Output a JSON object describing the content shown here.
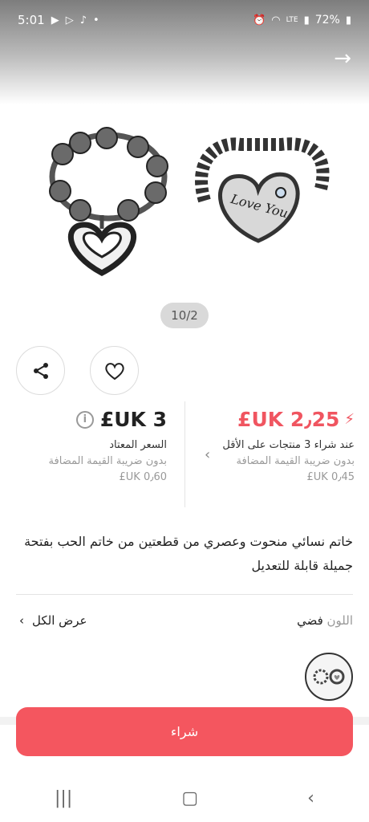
{
  "status": {
    "time": "5:01",
    "battery": "72%",
    "lte_label": "LTE"
  },
  "gallery": {
    "counter": "10/2",
    "engraving": "Love You"
  },
  "pricing": {
    "sale_price": "£UK 2٫25",
    "sale_condition": "عند شراء 3 منتجات على الأقل",
    "sale_vat_note": "بدون ضريبة القيمة المضافة",
    "sale_vat_amount": "£UK 0٫45",
    "regular_price": "£UK 3",
    "regular_label": "السعر المعتاد",
    "regular_vat_note": "بدون ضريبة القيمة المضافة",
    "regular_vat_amount": "£UK 0٫60"
  },
  "product": {
    "description": "خاتم نسائي منحوت وعصري من قطعتين من خاتم الحب بفتحة جميلة قابلة للتعديل"
  },
  "variant": {
    "color_key": "اللون",
    "color_value": "فضي",
    "view_all": "عرض الكل"
  },
  "actions": {
    "buy_label": "شراء"
  },
  "colors": {
    "accent": "#f4565f",
    "sale_price": "#f05560"
  }
}
